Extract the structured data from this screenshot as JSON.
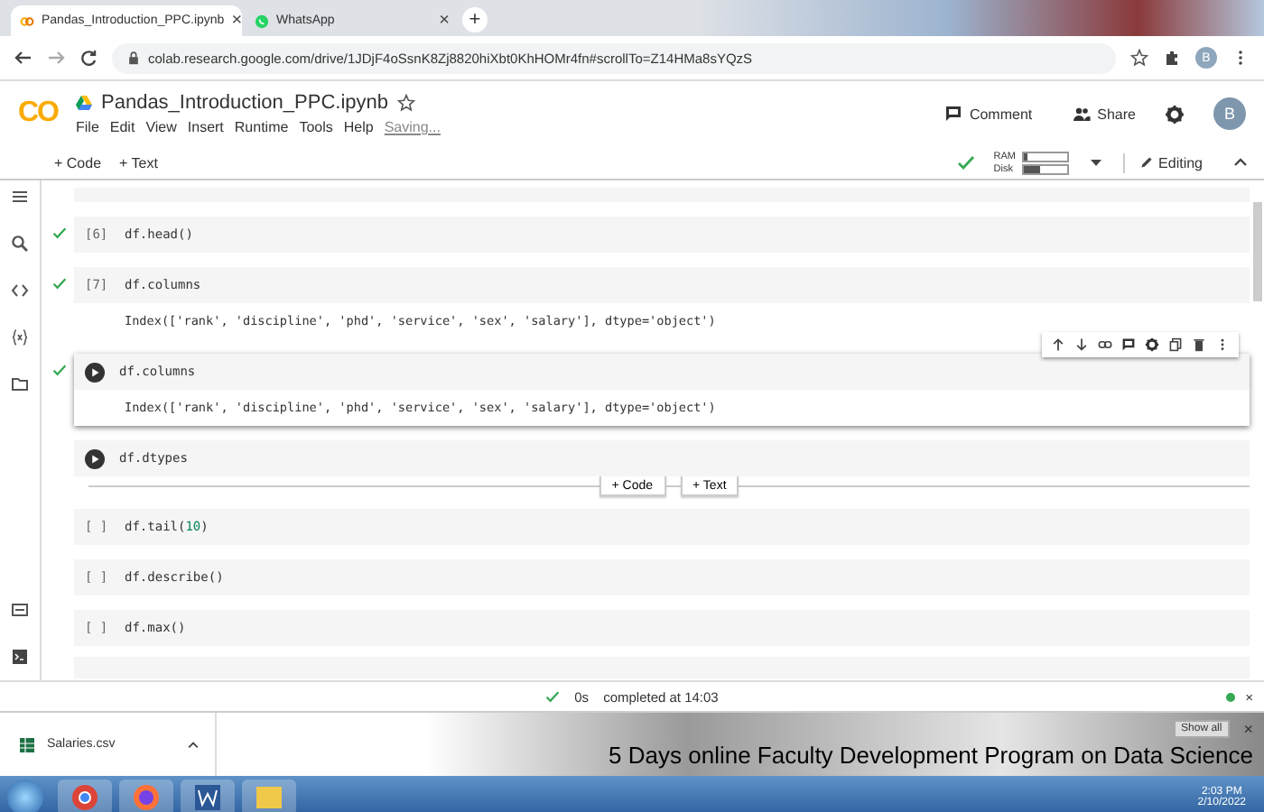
{
  "browser": {
    "tabs": [
      {
        "title": "Pandas_Introduction_PPC.ipynb",
        "selected": true,
        "close": "×"
      },
      {
        "title": "WhatsApp",
        "selected": false,
        "close": "×"
      }
    ],
    "new_tab": "+",
    "url": "colab.research.google.com/drive/1JDjF4oSsnK8Zj8820hiXbt0KhHOMr4fn#scrollTo=Z14HMa8sYQzS",
    "profile": "B"
  },
  "notebook": {
    "logo": "CO",
    "title": "Pandas_Introduction_PPC.ipynb",
    "menu": [
      "File",
      "Edit",
      "View",
      "Insert",
      "Runtime",
      "Tools",
      "Help"
    ],
    "save_status": "Saving...",
    "actions": [
      {
        "label": "Comment",
        "kind": "comment"
      },
      {
        "label": "Share",
        "kind": "share"
      }
    ],
    "avatar": "B",
    "toolbar": {
      "add": [
        "+ Code",
        "+ Text"
      ],
      "ram_label": "RAM",
      "disk_label": "Disk",
      "ram": {
        "level": 0.1
      },
      "disk": {
        "level": 0.4
      },
      "mode": "Editing"
    }
  },
  "cells": [
    {
      "kind": "prompt",
      "prompt": "[6]",
      "code": "df.head()",
      "executed": true,
      "focused": false
    },
    {
      "kind": "prompt",
      "prompt": "[7]",
      "code": "df.columns",
      "executed": true,
      "focused": false,
      "output": "Index(['rank', 'discipline', 'phd', 'service', 'sex', 'salary'], dtype='object')"
    },
    {
      "kind": "run",
      "code": "df.columns",
      "executed": true,
      "focused": true,
      "output": "Index(['rank', 'discipline', 'phd', 'service', 'sex', 'salary'], dtype='object')"
    },
    {
      "kind": "run",
      "code": "df.dtypes",
      "executed": false,
      "focused": false
    },
    {
      "kind": "divider",
      "buttons": [
        "+ Code",
        "+ Text"
      ]
    },
    {
      "kind": "prompt",
      "prompt": "[ ]",
      "code": "df.tail(",
      "arg": "10",
      "code_end": ")",
      "executed": false,
      "focused": false
    },
    {
      "kind": "prompt",
      "prompt": "[ ]",
      "code": "df.describe()",
      "executed": false,
      "focused": false
    },
    {
      "kind": "prompt",
      "prompt": "[ ]",
      "code": "df.max()",
      "executed": false,
      "focused": false
    }
  ],
  "status_bar": {
    "duration": "0s",
    "message": "completed at 14:03",
    "close": "×"
  },
  "downloads": {
    "file": "Salaries.csv",
    "show_all": "Show all",
    "close": "×"
  },
  "caption": "5 Days online Faculty Development Program on Data Science",
  "taskbar": {
    "time": "2:03 PM",
    "date": "2/10/2022"
  }
}
